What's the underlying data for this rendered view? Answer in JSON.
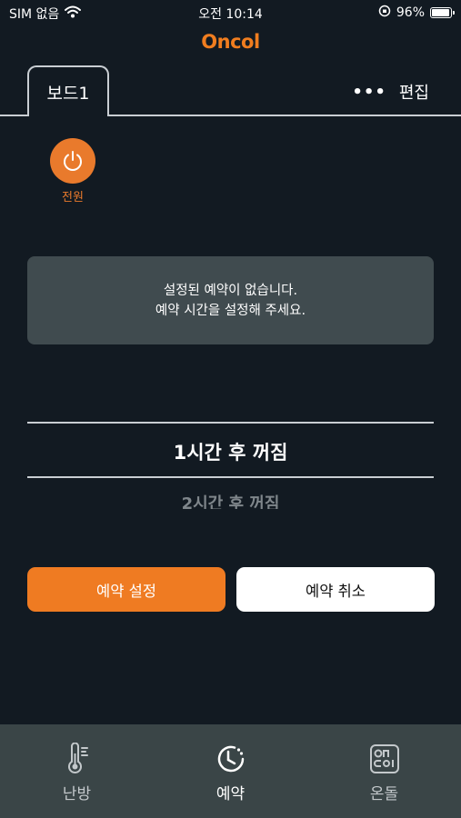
{
  "status_bar": {
    "carrier": "SIM 없음",
    "time": "오전 10:14",
    "battery_percent": "96%",
    "battery_level": 0.96
  },
  "app": {
    "brand": "Oncol"
  },
  "tabs": {
    "active_label": "보드1",
    "more": "•••",
    "edit_label": "편집"
  },
  "power": {
    "label": "전원",
    "color": "#e97a2c"
  },
  "notice": {
    "line1": "설정된 예약이 없습니다.",
    "line2": "예약 시간을 설정해 주세요."
  },
  "picker": {
    "selected": "1시간 후 꺼짐",
    "next": "2시간 후 꺼짐"
  },
  "actions": {
    "set_label": "예약 설정",
    "cancel_label": "예약 취소",
    "accent": "#ef7b22"
  },
  "nav": {
    "items": [
      {
        "label": "난방",
        "icon": "thermometer-icon"
      },
      {
        "label": "예약",
        "icon": "clock-icon"
      },
      {
        "label": "온돌",
        "icon": "oncol-logo-icon"
      }
    ],
    "active_index": 1
  }
}
